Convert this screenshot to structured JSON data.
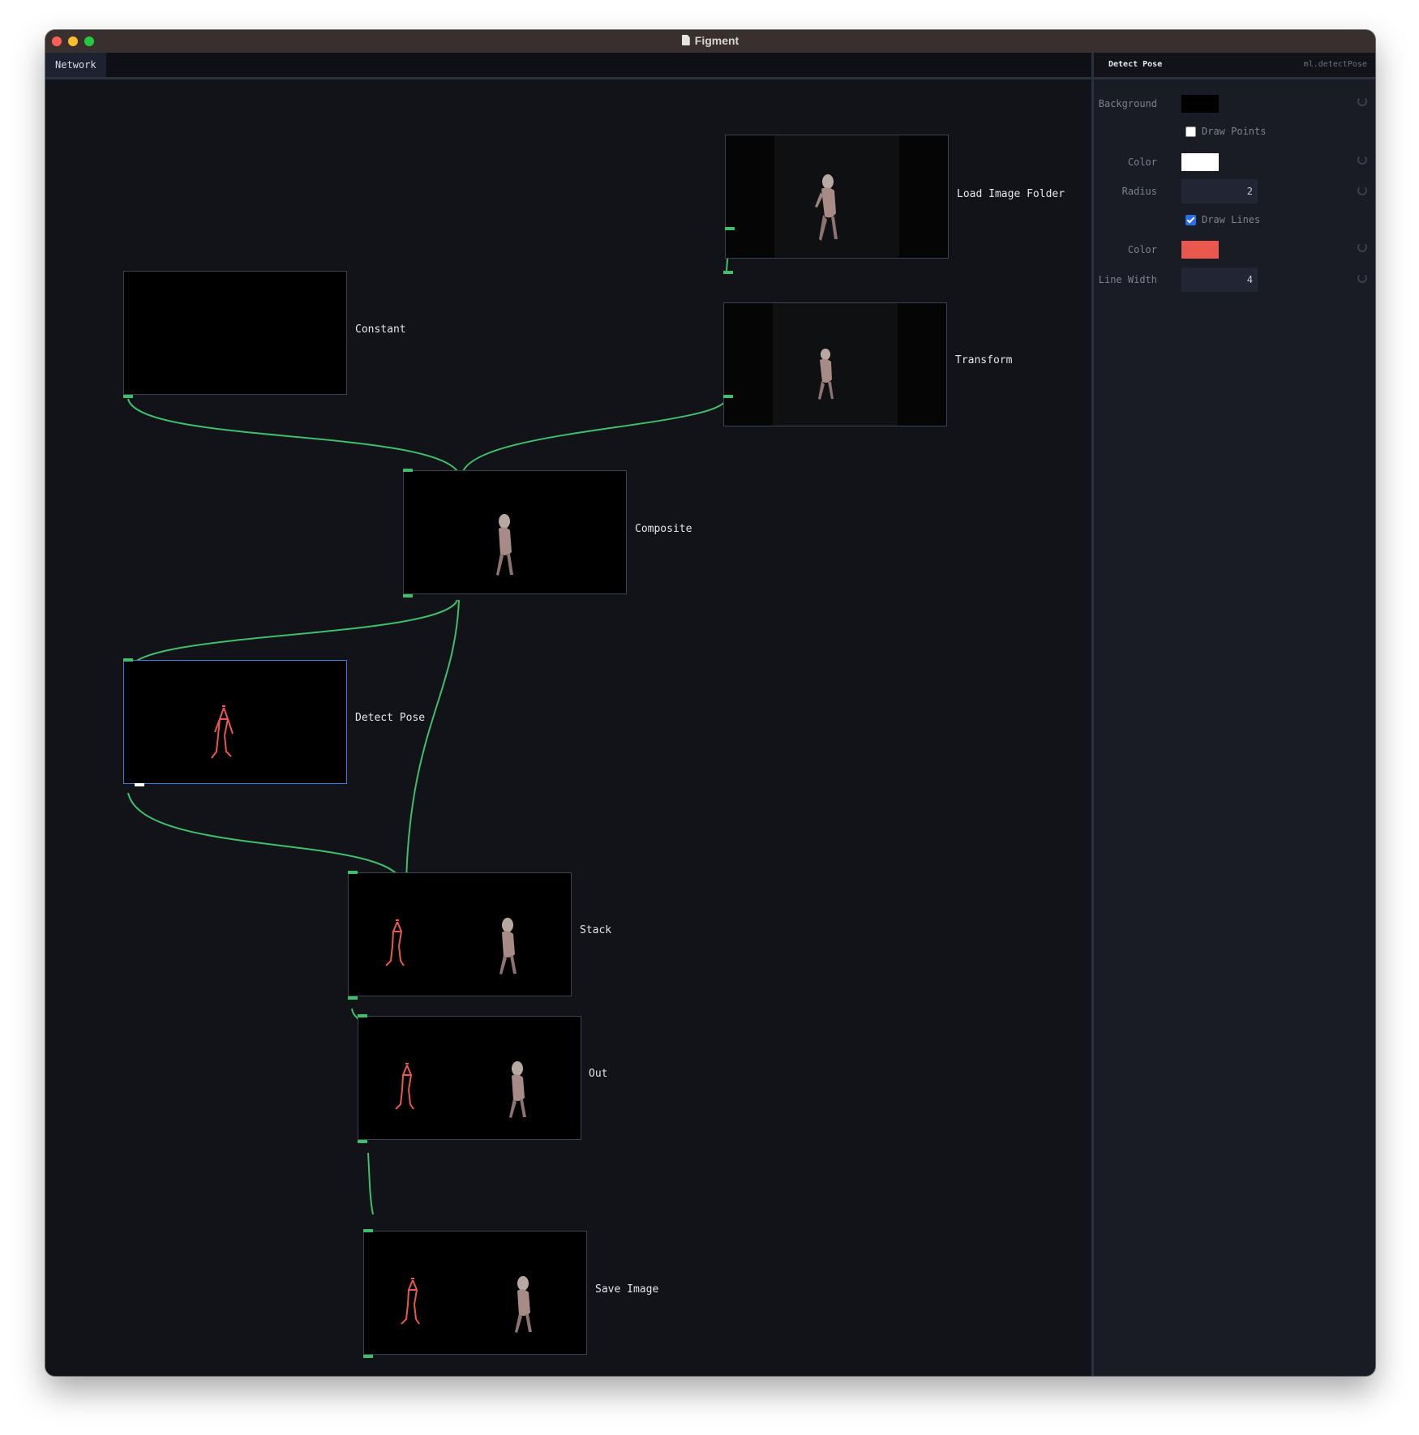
{
  "window": {
    "title": "Figment"
  },
  "tabs": [
    {
      "label": "Network"
    }
  ],
  "panel": {
    "title": "Detect Pose",
    "operator": "ml.detectPose",
    "params": {
      "background": {
        "label": "Background",
        "color": "#000000"
      },
      "draw_points": {
        "label": "Draw Points",
        "checked": false
      },
      "points_color": {
        "label": "Color",
        "color": "#ffffff"
      },
      "radius": {
        "label": "Radius",
        "value": "2"
      },
      "draw_lines": {
        "label": "Draw Lines",
        "checked": true
      },
      "lines_color": {
        "label": "Color",
        "color": "#e8584c"
      },
      "line_width": {
        "label": "Line Width",
        "value": "4"
      }
    }
  },
  "nodes": [
    {
      "id": "load",
      "label": "Load Image Folder",
      "preview": "person-pillarbox"
    },
    {
      "id": "transform",
      "label": "Transform",
      "preview": "person-pillarbox"
    },
    {
      "id": "constant",
      "label": "Constant",
      "preview": "black"
    },
    {
      "id": "composite",
      "label": "Composite",
      "preview": "person"
    },
    {
      "id": "detect",
      "label": "Detect Pose",
      "preview": "pose-skeleton",
      "selected": true
    },
    {
      "id": "stack",
      "label": "Stack",
      "preview": "skeleton-and-person"
    },
    {
      "id": "out",
      "label": "Out",
      "preview": "skeleton-and-person"
    },
    {
      "id": "save",
      "label": "Save Image",
      "preview": "skeleton-and-person"
    }
  ],
  "connections": [
    {
      "from": "load",
      "to": "transform"
    },
    {
      "from": "constant",
      "to": "composite"
    },
    {
      "from": "transform",
      "to": "composite"
    },
    {
      "from": "composite",
      "to": "detect"
    },
    {
      "from": "composite",
      "to": "stack"
    },
    {
      "from": "detect",
      "to": "stack"
    },
    {
      "from": "stack",
      "to": "out"
    },
    {
      "from": "out",
      "to": "save"
    }
  ],
  "colors": {
    "wire": "#3fbf6b",
    "selection": "#3c7ee0",
    "skeleton": "#e8584c"
  }
}
